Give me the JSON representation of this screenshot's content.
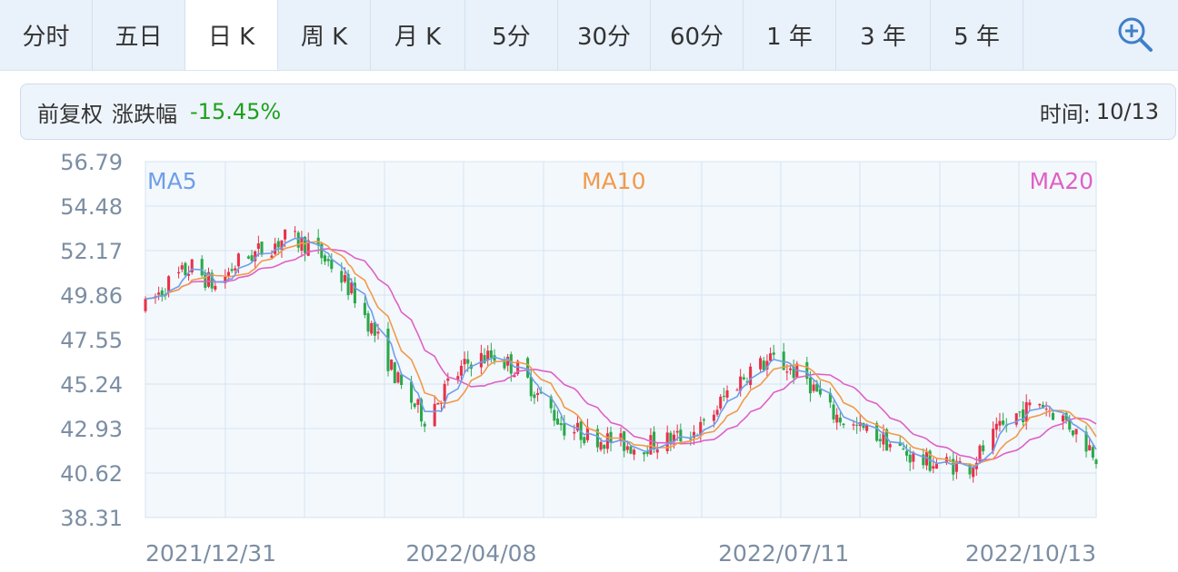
{
  "tabs": {
    "items": [
      "分时",
      "五日",
      "日 K",
      "周 K",
      "月 K",
      "5分",
      "30分",
      "60分",
      "1 年",
      "3 年",
      "5 年"
    ],
    "active": 2
  },
  "info": {
    "adjust": "前复权",
    "change_label": "涨跌幅",
    "change_value": "-15.45%",
    "time_label": "时间:",
    "time_value": "10/13"
  },
  "colors": {
    "up": "#e8314a",
    "down": "#2aa84a",
    "ma5": "#6f9ee8",
    "ma10": "#f29a4a",
    "ma20": "#e060c4",
    "grid": "#d5e3f1",
    "plot_bg": "#f3f8fd"
  },
  "chart_data": {
    "type": "candlestick",
    "y_ticks": [
      "56.79",
      "54.48",
      "52.17",
      "49.86",
      "47.55",
      "45.24",
      "42.93",
      "40.62",
      "38.31"
    ],
    "ylim": [
      38.31,
      56.79
    ],
    "x_tick_labels": [
      "2021/12/31",
      "2022/04/08",
      "2022/07/11",
      "2022/10/13"
    ],
    "grid": true,
    "legend": [
      "MA5",
      "MA10",
      "MA20"
    ],
    "ma_trend_anchors": [
      [
        "2021/12/31",
        49.2
      ],
      [
        "2022/01/07",
        50.5
      ],
      [
        "2022/01/14",
        51.3
      ],
      [
        "2022/01/21",
        50.3
      ],
      [
        "2022/01/28",
        51.6
      ],
      [
        "2022/02/11",
        52.8
      ],
      [
        "2022/02/18",
        52.5
      ],
      [
        "2022/02/25",
        51.4
      ],
      [
        "2022/03/04",
        49.8
      ],
      [
        "2022/03/11",
        47.5
      ],
      [
        "2022/03/18",
        45.0
      ],
      [
        "2022/03/25",
        43.5
      ],
      [
        "2022/04/01",
        45.2
      ],
      [
        "2022/04/08",
        46.5
      ],
      [
        "2022/04/15",
        46.7
      ],
      [
        "2022/04/22",
        46.0
      ],
      [
        "2022/04/29",
        44.5
      ],
      [
        "2022/05/06",
        43.0
      ],
      [
        "2022/05/13",
        42.6
      ],
      [
        "2022/05/20",
        42.3
      ],
      [
        "2022/05/27",
        42.0
      ],
      [
        "2022/06/03",
        42.2
      ],
      [
        "2022/06/10",
        42.5
      ],
      [
        "2022/06/17",
        43.0
      ],
      [
        "2022/06/24",
        44.8
      ],
      [
        "2022/07/01",
        46.0
      ],
      [
        "2022/07/08",
        46.5
      ],
      [
        "2022/07/11",
        46.2
      ],
      [
        "2022/07/18",
        45.5
      ],
      [
        "2022/07/25",
        43.8
      ],
      [
        "2022/08/01",
        43.0
      ],
      [
        "2022/08/08",
        42.6
      ],
      [
        "2022/08/15",
        41.8
      ],
      [
        "2022/08/22",
        41.2
      ],
      [
        "2022/08/29",
        41.1
      ],
      [
        "2022/09/05",
        41.0
      ],
      [
        "2022/09/12",
        42.5
      ],
      [
        "2022/09/19",
        43.6
      ],
      [
        "2022/09/26",
        44.3
      ],
      [
        "2022/10/04",
        43.3
      ],
      [
        "2022/10/13",
        41.6
      ]
    ]
  }
}
